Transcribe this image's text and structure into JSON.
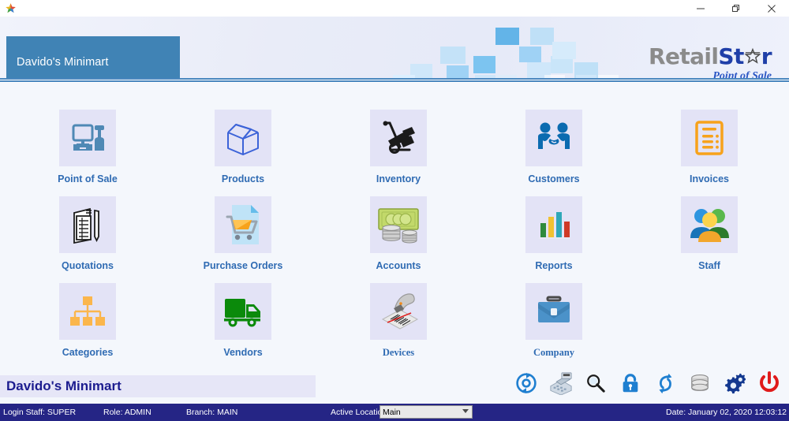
{
  "window": {
    "minimize_label": "minimize",
    "restore_label": "restore",
    "close_label": "close"
  },
  "header": {
    "company_plate": "Davido's Minimart",
    "logo": {
      "part1": "Retail",
      "part2": "St",
      "part3": "r",
      "star_icon": "star-icon",
      "tagline": "Point of Sale"
    },
    "accent_color": "#4083b5",
    "logo_blue": "#1f3fa8",
    "logo_gray": "#8b8b8b"
  },
  "menu": {
    "items": [
      {
        "label": "Point of Sale",
        "icon": "pos-terminal-icon",
        "font": "sans"
      },
      {
        "label": "Products",
        "icon": "open-box-icon",
        "font": "sans"
      },
      {
        "label": "Inventory",
        "icon": "hand-truck-icon",
        "font": "sans"
      },
      {
        "label": "Customers",
        "icon": "handshake-icon",
        "font": "sans"
      },
      {
        "label": "Invoices",
        "icon": "invoice-document-icon",
        "font": "sans"
      },
      {
        "label": "Quotations",
        "icon": "quotation-pen-icon",
        "font": "sans"
      },
      {
        "label": "Purchase Orders",
        "icon": "shopping-cart-icon",
        "font": "sans"
      },
      {
        "label": "Accounts",
        "icon": "money-coins-icon",
        "font": "sans"
      },
      {
        "label": "Reports",
        "icon": "bar-chart-icon",
        "font": "sans"
      },
      {
        "label": "Staff",
        "icon": "people-group-icon",
        "font": "sans"
      },
      {
        "label": "Categories",
        "icon": "hierarchy-icon",
        "font": "sans"
      },
      {
        "label": "Vendors",
        "icon": "delivery-truck-icon",
        "font": "sans"
      },
      {
        "label": "Devices",
        "icon": "barcode-scanner-icon",
        "font": "serif"
      },
      {
        "label": "Company",
        "icon": "briefcase-icon",
        "font": "serif"
      }
    ],
    "tile_background": "#e3e3f6",
    "label_color": "#2f6bb3"
  },
  "footer": {
    "company_name": "Davido's Minimart",
    "toolbar": [
      {
        "name": "refresh-button",
        "icon": "refresh-icon"
      },
      {
        "name": "cash-register-button",
        "icon": "cash-register-icon"
      },
      {
        "name": "search-button",
        "icon": "magnifier-icon"
      },
      {
        "name": "lock-button",
        "icon": "padlock-icon"
      },
      {
        "name": "sync-button",
        "icon": "sync-arrows-icon"
      },
      {
        "name": "database-button",
        "icon": "database-icon"
      },
      {
        "name": "settings-button",
        "icon": "gears-icon"
      },
      {
        "name": "power-button",
        "icon": "power-icon"
      }
    ]
  },
  "statusbar": {
    "login_staff": "Login Staff: SUPER",
    "role": "Role: ADMIN",
    "branch": "Branch: MAIN",
    "active_location_label": "Active Location",
    "active_location_value": "Main",
    "active_location_options": [
      "Main"
    ],
    "date": "Date: January 02, 2020 12:03:12",
    "background": "#252585"
  }
}
